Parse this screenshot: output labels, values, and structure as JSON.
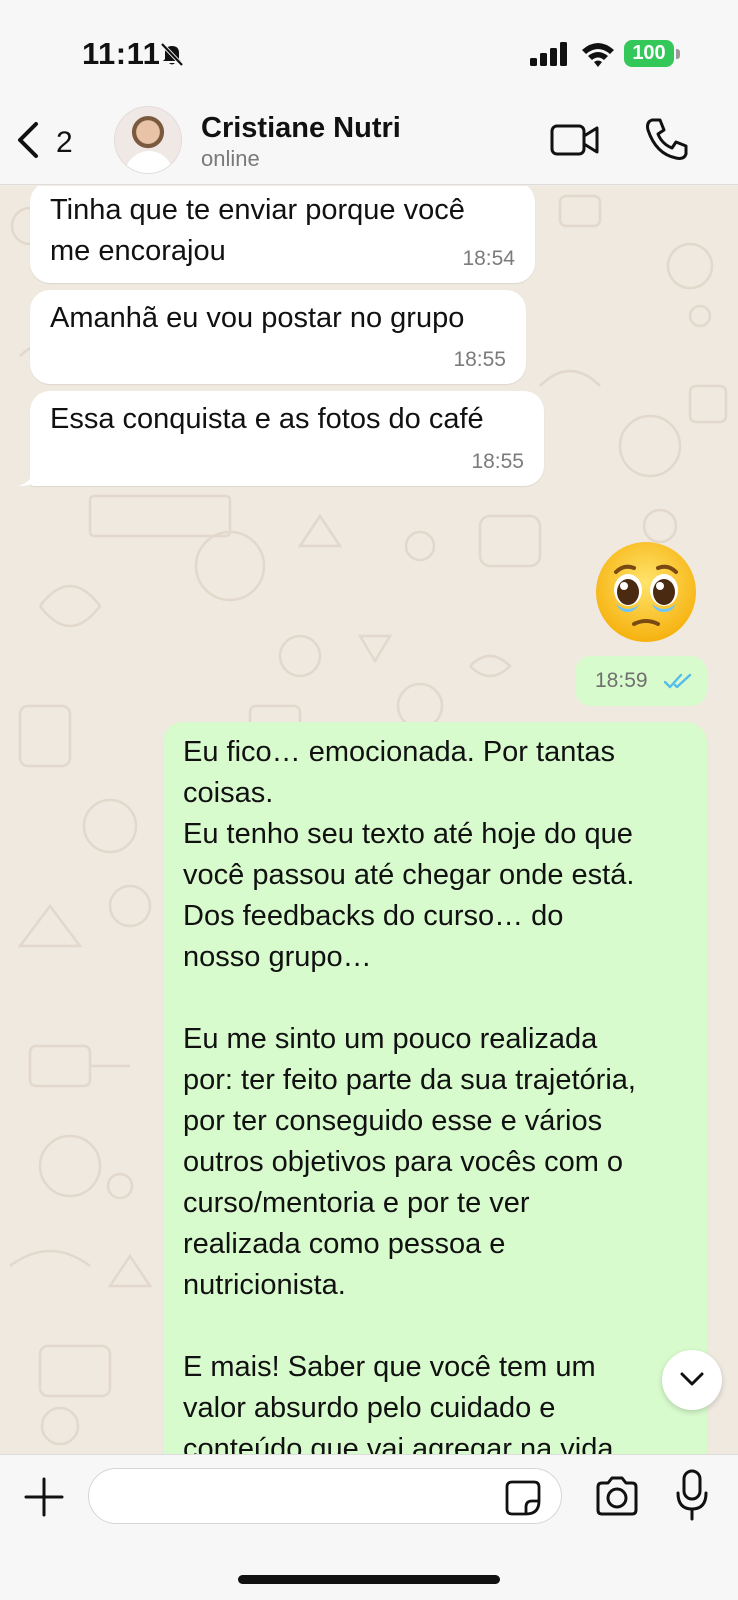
{
  "status_bar": {
    "time": "11:11",
    "battery_level": "100",
    "icons": [
      "bell-slash-icon",
      "signal-icon",
      "wifi-icon",
      "battery-icon"
    ],
    "battery_color": "#34c759"
  },
  "header": {
    "back_count": "2",
    "contact_name": "Cristiane Nutri",
    "contact_status": "online",
    "icons": [
      "chevron-left-icon",
      "video-camera-icon",
      "phone-icon"
    ]
  },
  "messages": [
    {
      "direction": "incoming",
      "text": "Tinha que te enviar porque você\nme encorajou",
      "time": "18:54"
    },
    {
      "direction": "incoming",
      "text": "Amanhã eu vou postar no grupo",
      "time": "18:55"
    },
    {
      "direction": "incoming",
      "text": "Essa conquista e as fotos do café",
      "time": "18:55"
    },
    {
      "direction": "outgoing",
      "type": "emoji",
      "emoji": "🥹",
      "time": "18:59",
      "read_status": "read"
    },
    {
      "direction": "outgoing",
      "text": "Eu fico… emocionada. Por tantas\ncoisas.\nEu tenho seu texto até hoje do que\nvocê passou até chegar onde está.\nDos feedbacks do curso… do\nnosso grupo…\n\nEu me sinto um pouco realizada\npor: ter feito parte da sua trajetória,\npor ter conseguido esse e vários\noutros objetivos para vocês com o\ncurso/mentoria e por te ver\nrealizada como pessoa e\nnutricionista.\n\nE mais! Saber que você tem um\nvalor absurdo pelo cuidado e\nconteúdo que vai agregar na vida"
    }
  ],
  "input_bar": {
    "placeholder": "",
    "icons": [
      "plus-icon",
      "sticker-icon",
      "camera-icon",
      "microphone-icon"
    ]
  },
  "colors": {
    "incoming_bubble": "#ffffff",
    "outgoing_bubble": "#d8fbcd",
    "read_ticks": "#53bdeb",
    "wallpaper": "#efe9e0"
  }
}
